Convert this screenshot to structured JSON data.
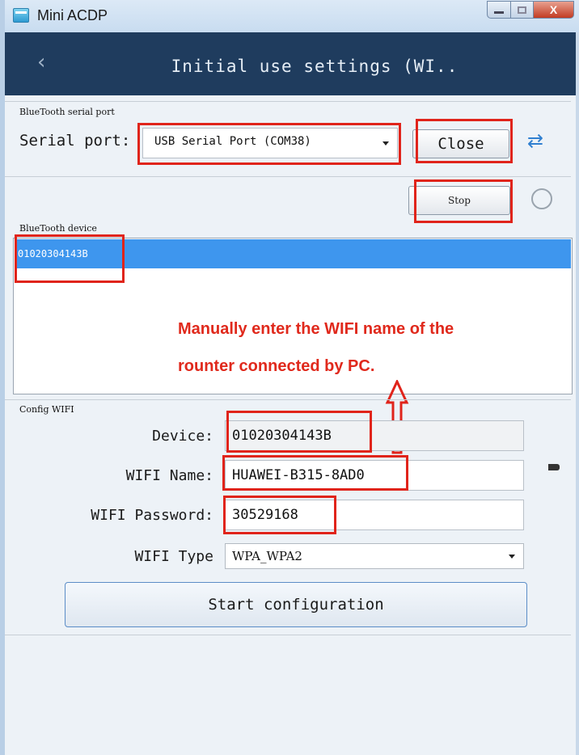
{
  "window": {
    "title": "Mini ACDP",
    "close_glyph": "X"
  },
  "header": {
    "back_icon": "‹",
    "title": "Initial use settings (WI.."
  },
  "serial_section": {
    "label": "BlueTooth serial port",
    "port_label": "Serial port:",
    "port_value": "USB Serial Port (COM38)",
    "close_button": "Close",
    "stop_button": "Stop"
  },
  "device_section": {
    "label": "BlueTooth device",
    "devices": [
      "01020304143B"
    ]
  },
  "annotation": {
    "line1": "Manually enter the WIFI name of the",
    "line2": "rounter connected by PC.",
    "color": "#e0291c"
  },
  "config_section": {
    "label": "Config WIFI",
    "device_label": "Device:",
    "device_value": "01020304143B",
    "wifi_name_label": "WIFI Name:",
    "wifi_name_value": "HUAWEI-B315-8AD0",
    "wifi_password_label": "WIFI Password:",
    "wifi_password_value": "30529168",
    "wifi_type_label": "WIFI Type",
    "wifi_type_value": "WPA_WPA2",
    "start_button": "Start configuration"
  },
  "colors": {
    "header_bg": "#1f3c5e",
    "selection": "#3e96ee",
    "highlight_box": "#e0241b"
  }
}
